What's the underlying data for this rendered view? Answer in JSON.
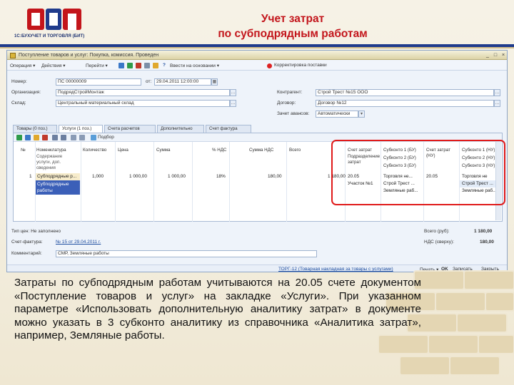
{
  "slide": {
    "title_line1": "Учет затрат",
    "title_line2": "по субподрядным работам",
    "logo_caption": "1С:БУХУЧЕТ И ТОРГОВЛЯ (БИТ)",
    "logo_letters": "БIТ",
    "description": "Затраты по субподрядным работам учитываются на 20.05 счете документом «Поступление товаров и услуг» на закладке «Услуги». При указанном параметре «Использовать дополнительную аналитику затрат» в документе можно указать в 3 субконто аналитику из справочника «Аналитика затрат», например, Земляные работы."
  },
  "window": {
    "title": "Поступление товаров и услуг: Покупка, комиссия. Проведен",
    "controls": [
      "_",
      "□",
      "×"
    ],
    "toolbar": {
      "operation": "Операция ▾",
      "actions": "Действия ▾",
      "goto": "Перейти ▾",
      "help": "?",
      "hint": "Ввести на основании ▾",
      "agent_contract": "Корректировка поставки"
    }
  },
  "form": {
    "number_label": "Номер:",
    "number_value": "ПС 00000009",
    "date_label": "от:",
    "date_value": "29.04.2011 12:00:00",
    "org_label": "Организация:",
    "org_value": "ПодрядСтройМонтаж",
    "warehouse_label": "Склад:",
    "warehouse_value": "Центральный материальный склад",
    "counterparty_label": "Контрагент:",
    "counterparty_value": "Строй Трест №15 ООО",
    "contract_label": "Договор:",
    "contract_value": "Договор №12",
    "account_label": "Зачет авансов:",
    "account_value": "Автоматически"
  },
  "tabs": [
    {
      "label": "Товары (0 поз.)",
      "active": false
    },
    {
      "label": "Услуги (1 поз.)",
      "active": true
    },
    {
      "label": "Счета расчетов",
      "active": false
    },
    {
      "label": "Дополнительно",
      "active": false
    },
    {
      "label": "Счет фактура",
      "active": false
    }
  ],
  "grid": {
    "select_label": "Подбор",
    "headers": [
      "№",
      "Номенклатура",
      "Количество",
      "Цена",
      "Сумма",
      "% НДС",
      "Сумма НДС",
      "Всего",
      "Счет затрат",
      "Субконто 1 (БУ)",
      "Счет затрат (НУ)",
      "Субконто 1 (НУ)"
    ],
    "sub_headers": {
      "nomenclature": "Содержание услуги, доп. сведения",
      "account": "Подразделение затрат",
      "sub2": "Субконто 2 (БУ)",
      "sub3": "Субконто 3 (БУ)",
      "sub2nu": "Субконто 2 (НУ)",
      "sub3nu": "Субконто 3 (НУ)"
    },
    "row": {
      "num": "1",
      "nomenclature": "Субподрядные р...",
      "content": "Субподрядные работы",
      "quantity": "1,000",
      "price": "1 000,00",
      "sum": "1 000,00",
      "vat_rate": "18%",
      "vat_sum": "180,00",
      "total": "1 180,00",
      "account": "20.05",
      "sub1": "Торговля не...",
      "account_nu": "20.05",
      "sub1_nu": "Торговля не",
      "department": "Участок №1",
      "sub2": "Строй Трест ...",
      "sub2_nu": "Строй Трест ...",
      "sub3": "Земляные раб...",
      "sub3_nu": "Земляные раб..."
    }
  },
  "footer": {
    "price_type_label": "Тип цен: Не заполнено",
    "invoice_label": "Счет-фактура:",
    "invoice_value": "№ 15 от 29.04.2011 г.",
    "comment_label": "Комментарий:",
    "comment_value": "СМР, Земляные работы",
    "total_label": "Всего (руб):",
    "total_value": "1 180,00",
    "vat_label": "НДС (сверху):",
    "vat_value": "180,00",
    "status_text": "ТОРГ-12 (Товарная накладная за товары с услугами)",
    "print_btn": "Печать ▾",
    "ok_btn": "OK",
    "save_btn": "Записать",
    "close_btn": "Закрыть"
  },
  "colors": {
    "title_red": "#c3151b",
    "brand_blue": "#1f3b8c",
    "highlight_red": "#e01a1a",
    "window_bg": "#eef3fa"
  }
}
